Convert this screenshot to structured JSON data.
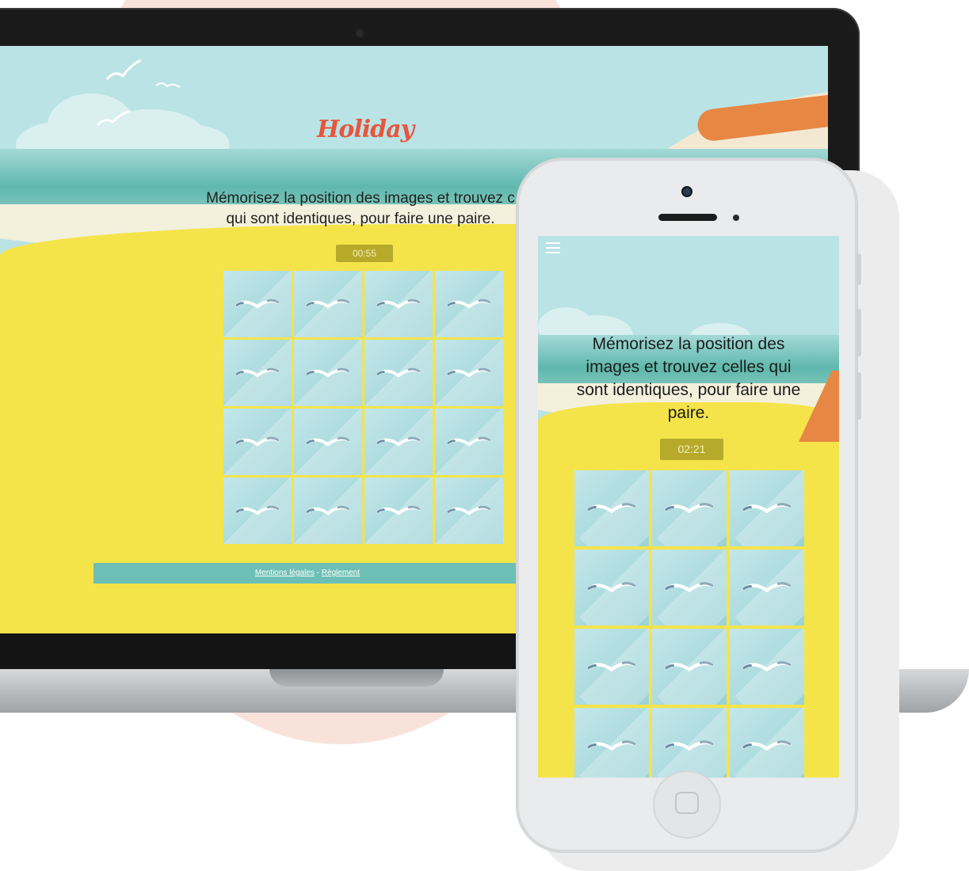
{
  "desktop": {
    "logo": "Holiday",
    "intro": "Mémorisez la position des images et trouvez c",
    "intro_line2": "qui sont identiques, pour faire une paire.",
    "timer": "00:55",
    "card_count": 16,
    "footer": {
      "legal_link": "Mentions légales",
      "separator": " - ",
      "rules_link": "Règlement"
    }
  },
  "mobile": {
    "menu_icon": "hamburger-icon",
    "intro": "Mémorisez la position des images et trouvez celles qui sont identiques, pour faire une paire.",
    "timer": "02:21",
    "card_count": 12
  },
  "colors": {
    "sky": "#b9e3e4",
    "sand": "#f4e44a",
    "sea": "#5fb8ad",
    "timer_bg": "#b7a92a",
    "logo": "#e6553d",
    "footer_bg": "#6dbfb5"
  }
}
